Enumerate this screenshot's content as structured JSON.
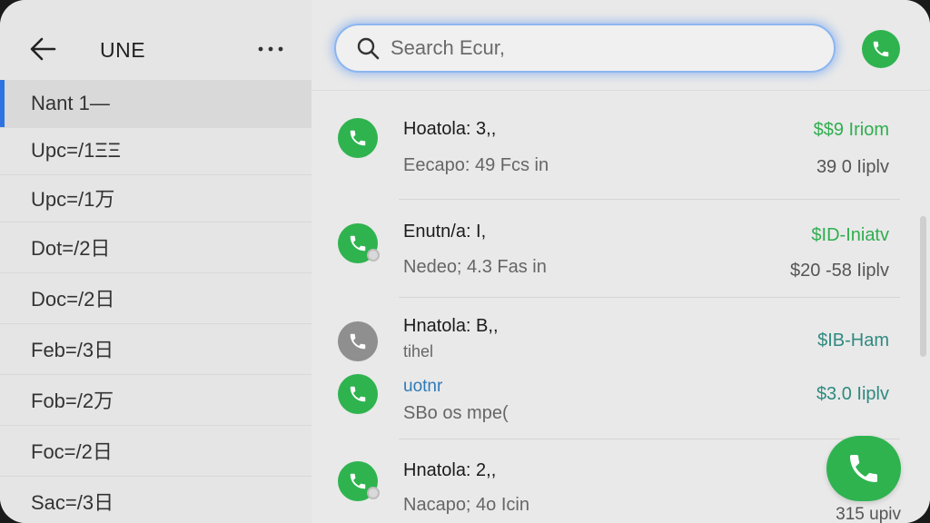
{
  "sidebar": {
    "title": "UNE",
    "items": [
      {
        "label": "Nant 1—"
      },
      {
        "label": "Upc=/1ΞΞ"
      },
      {
        "label": "Upc=/1万"
      },
      {
        "label": "Dot=/2日"
      },
      {
        "label": "Doc=/2日"
      },
      {
        "label": "Feb=/3日"
      },
      {
        "label": "Fob=/2万"
      },
      {
        "label": "Foc=/2日"
      },
      {
        "label": "Sac=/3日"
      }
    ]
  },
  "search": {
    "placeholder": "Search Ecur,"
  },
  "calls": [
    {
      "name": "Hoatola: 3,,",
      "sub": "Eecapo:  49 Fcs in",
      "amount_top": "$$9 Iriom",
      "amount_bottom": "39 0 Iiplv"
    },
    {
      "name": "Enutn/a: I,",
      "sub": "Nedeo;  4.3 Fas in",
      "amount_top": "$ID-Iniatv",
      "amount_bottom": "$20 -58 Iiplv"
    },
    {
      "name": "Hnatola: B,,",
      "sub": "tihel",
      "amount_top": "$IB-Ham",
      "amount_bottom": ""
    },
    {
      "name": "uotnr",
      "sub": "SBo os mpe(",
      "amount_top": "$3.0 Iiplv",
      "amount_bottom": ""
    },
    {
      "name": "Hnatola: 2,,",
      "sub": "Nacapo;  4o Icin",
      "amount_top": "",
      "amount_bottom": ""
    }
  ],
  "fab": {
    "label": "315 upiv"
  },
  "colors": {
    "accent": "#2fb34f",
    "active_indicator": "#2f73e0",
    "search_glow": "#8cb6f0"
  }
}
